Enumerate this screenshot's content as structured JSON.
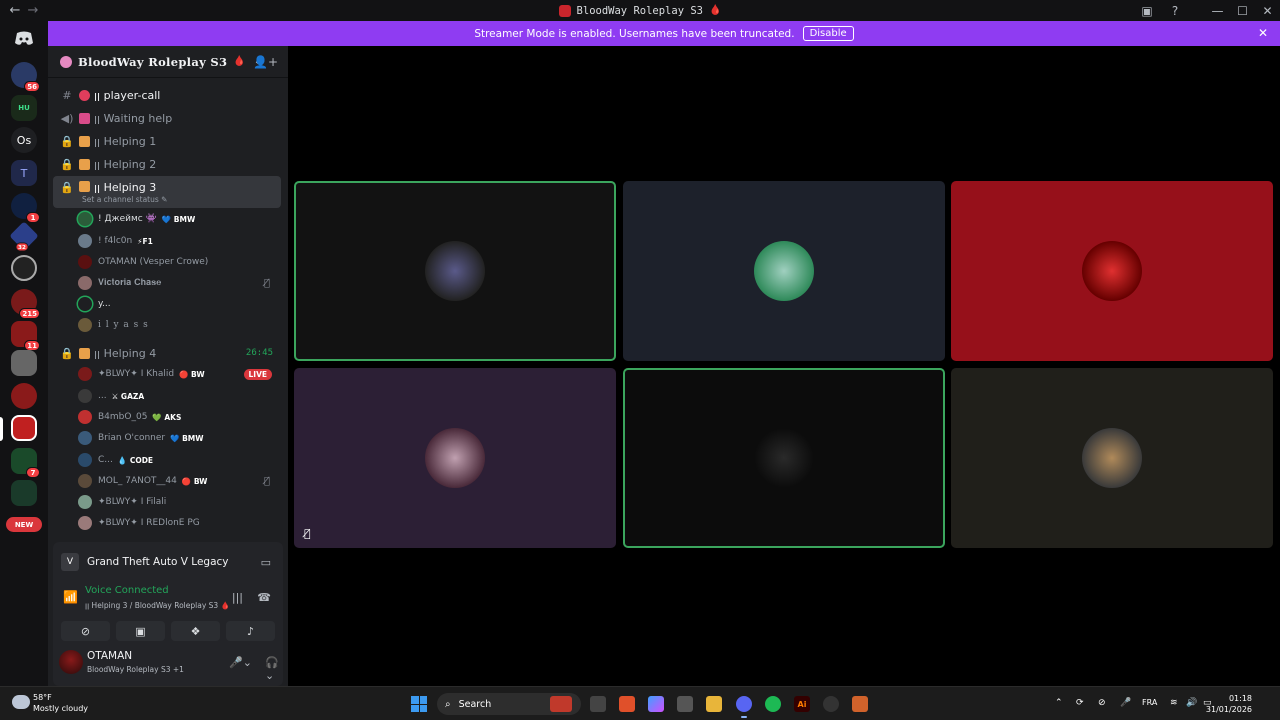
{
  "window": {
    "title": "BloodWay Roleplay S3",
    "back_glyph": "←",
    "forward_glyph": "→"
  },
  "banner": {
    "text": "Streamer Mode is enabled. Usernames have been truncated.",
    "button": "Disable"
  },
  "rail": {
    "items": [
      {
        "label": "",
        "badge": "",
        "color": "#5865f2"
      },
      {
        "label": "",
        "badge": "56",
        "color": "#2a3a66"
      },
      {
        "label": "HU",
        "badge": "",
        "color": "#1a2a1a"
      },
      {
        "label": "Os",
        "badge": "",
        "color": "#1e1f22"
      },
      {
        "label": "T",
        "badge": "",
        "color": "#20284a"
      },
      {
        "label": "",
        "badge": "1",
        "color": "#102040"
      },
      {
        "label": "",
        "badge": "32",
        "color": "#2b3f8a"
      },
      {
        "label": "",
        "badge": "",
        "color": "#222"
      },
      {
        "label": "",
        "badge": "215",
        "color": "#7a1a1a"
      },
      {
        "label": "",
        "badge": "11",
        "color": "#8a1a1a"
      },
      {
        "label": "",
        "badge": "",
        "color": "#666"
      },
      {
        "label": "",
        "badge": "",
        "color": "#8a1a1a"
      },
      {
        "label": "",
        "badge": "",
        "color": "#c02020"
      },
      {
        "label": "",
        "badge": "7",
        "color": "#1a4a2a"
      },
      {
        "label": "",
        "badge": "",
        "color": "#1a3a2a"
      }
    ],
    "new_label": "NEW"
  },
  "guild": {
    "name": "BloodWay Roleplay S3"
  },
  "channels": [
    {
      "icon": "#",
      "emoji_color": "#e03d5c",
      "name": "ꞁꞁ player-call",
      "bright": true,
      "active": false,
      "time": ""
    },
    {
      "icon": "🔊",
      "emoji_color": "#d94c8a",
      "name": "ꞁꞁ Waiting help",
      "bright": false,
      "active": false,
      "time": ""
    },
    {
      "icon": "🔒",
      "emoji_color": "#e8a04a",
      "name": "ꞁꞁ Helping 1",
      "bright": false,
      "active": false,
      "time": ""
    },
    {
      "icon": "🔒",
      "emoji_color": "#e8a04a",
      "name": "ꞁꞁ Helping 2",
      "bright": false,
      "active": false,
      "time": ""
    },
    {
      "icon": "🔒",
      "emoji_color": "#e8a04a",
      "name": "ꞁꞁ Helping 3",
      "bright": true,
      "active": true,
      "time": ""
    },
    {
      "icon": "🔒",
      "emoji_color": "#e8a04a",
      "name": "ꞁꞁ Helping 4",
      "bright": false,
      "active": false,
      "time": "26:45"
    }
  ],
  "set_status": "Set a channel status ✎",
  "helping3_users": [
    {
      "name": "! Джеймс 👾",
      "tag": "💙 BMW",
      "av": "#2b5d3a",
      "bright": true,
      "muted": false
    },
    {
      "name": "! f4lc0n",
      "tag": "⚡F1",
      "av": "#6a7a8a",
      "bright": false,
      "muted": false
    },
    {
      "name": "OTAMAN (Vesper Crowe)",
      "tag": "",
      "av": "#5a1010",
      "bright": false,
      "muted": false
    },
    {
      "name": "𝐕𝐢𝐜𝐭𝐨𝐫𝐢𝐚 𝐂𝐡𝐚𝐬𝐞",
      "tag": "",
      "av": "#8a6a6a",
      "bright": false,
      "muted": true
    },
    {
      "name": "y...",
      "tag": "",
      "av": "#1e1f22",
      "bright": true,
      "muted": false
    },
    {
      "name": "i l y a s s",
      "tag": "",
      "av": "#6a5a3a",
      "bright": false,
      "muted": false
    }
  ],
  "helping4_users": [
    {
      "name": "✦BLWY✦ I Khalid",
      "tag": "🔴 BW",
      "av": "#7a1a1a",
      "bright": false,
      "muted": false,
      "live": "LIVE"
    },
    {
      "name": "...",
      "tag": "⚔ GAZA",
      "av": "#3a3a3a",
      "bright": false,
      "muted": false,
      "live": ""
    },
    {
      "name": "B4mbO_05",
      "tag": "💚 AKS",
      "av": "#c03030",
      "bright": false,
      "muted": false,
      "live": ""
    },
    {
      "name": "Brian O'conner",
      "tag": "💙 BMW",
      "av": "#3a5a7a",
      "bright": false,
      "muted": false,
      "live": ""
    },
    {
      "name": "C...",
      "tag": "💧 CODE",
      "av": "#2a4a6a",
      "bright": false,
      "muted": false,
      "live": ""
    },
    {
      "name": "MOL_ 7ANOT__44",
      "tag": "🔴 BW",
      "av": "#5a4a3a",
      "bright": false,
      "muted": true,
      "live": ""
    },
    {
      "name": "✦BLWY✦ I Filali",
      "tag": "",
      "av": "#7a9a8a",
      "bright": false,
      "muted": false,
      "live": ""
    },
    {
      "name": "✦BLWY✦ I REDlonE PG",
      "tag": "",
      "av": "#9a7a7a",
      "bright": false,
      "muted": false,
      "live": ""
    }
  ],
  "activity": {
    "game": "Grand Theft Auto V Legacy",
    "voice_title": "Voice Connected",
    "voice_sub": "ꞁꞁ Helping 3 / BloodWay Roleplay S3 🩸"
  },
  "me": {
    "name": "OTAMAN",
    "sub": "BloodWay Roleplay S3 +1"
  },
  "tiles": [
    {
      "bg": "#121212",
      "speaking": true,
      "av": "#3a3a5a",
      "muted": false
    },
    {
      "bg": "#1d212b",
      "speaking": false,
      "av": "#2f8a5a",
      "muted": false
    },
    {
      "bg": "#96101a",
      "speaking": false,
      "av": "#b81a1a",
      "muted": false
    },
    {
      "bg": "#2c1f35",
      "speaking": false,
      "av": "#7a4a6a",
      "muted": true
    },
    {
      "bg": "#0c0c0c",
      "speaking": true,
      "av": "#151515",
      "muted": false
    },
    {
      "bg": "#201f1a",
      "speaking": false,
      "av": "#6a6a6a",
      "muted": false
    }
  ],
  "taskbar": {
    "temp": "58°F",
    "weather": "Mostly cloudy",
    "search": "Search",
    "lang": "FRA",
    "time": "01:18",
    "date": "31/01/2026"
  }
}
